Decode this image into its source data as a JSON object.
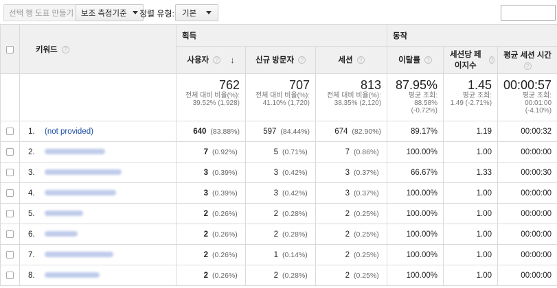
{
  "toolbar": {
    "create_label": "선택 행 도표 만들기",
    "secondary_dim_label": "보조 측정기준",
    "sort_type_label": "정렬 유형:",
    "sort_type_value": "기본"
  },
  "table": {
    "keyword_header": "키워드",
    "groups": {
      "acquisition": "획득",
      "behavior": "동작"
    },
    "columns": {
      "users": "사용자",
      "new_users": "신규 방문자",
      "sessions": "세션",
      "bounce_rate": "이탈률",
      "pages_per_session": "세션당 페이지수",
      "avg_session_duration": "평균 세션 시간"
    },
    "totals": {
      "users": {
        "value": "762",
        "l1": "전체 대비 비율(%):",
        "l2": "39.52% (1,928)"
      },
      "new_users": {
        "value": "707",
        "l1": "전체 대비 비율(%):",
        "l2": "41.10% (1,720)"
      },
      "sessions": {
        "value": "813",
        "l1": "전체 대비 비율(%):",
        "l2": "38.35% (2,120)"
      },
      "bounce_rate": {
        "value": "87.95%",
        "l1": "평균 조회:",
        "l2": "88.58%",
        "l3": "(-0.72%)"
      },
      "pages_per_session": {
        "value": "1.45",
        "l1": "평균 조회:",
        "l2": "1.49 (-2.71%)"
      },
      "avg_session_duration": {
        "value": "00:00:57",
        "l1": "평균 조회:",
        "l2": "00:01:00",
        "l3": "(-4.10%)"
      }
    },
    "rows": [
      {
        "idx": "1.",
        "keyword": "(not provided)",
        "users": "640",
        "users_pct": "(83.88%)",
        "new_users": "597",
        "new_users_pct": "(84.44%)",
        "sessions": "674",
        "sessions_pct": "(82.90%)",
        "bounce": "89.17%",
        "pps": "1.19",
        "dur": "00:00:32"
      },
      {
        "idx": "2.",
        "keyword": "",
        "users": "7",
        "users_pct": "(0.92%)",
        "new_users": "5",
        "new_users_pct": "(0.71%)",
        "sessions": "7",
        "sessions_pct": "(0.86%)",
        "bounce": "100.00%",
        "pps": "1.00",
        "dur": "00:00:00"
      },
      {
        "idx": "3.",
        "keyword": "",
        "users": "3",
        "users_pct": "(0.39%)",
        "new_users": "3",
        "new_users_pct": "(0.42%)",
        "sessions": "3",
        "sessions_pct": "(0.37%)",
        "bounce": "66.67%",
        "pps": "1.33",
        "dur": "00:00:30"
      },
      {
        "idx": "4.",
        "keyword": "",
        "users": "3",
        "users_pct": "(0.39%)",
        "new_users": "3",
        "new_users_pct": "(0.42%)",
        "sessions": "3",
        "sessions_pct": "(0.37%)",
        "bounce": "100.00%",
        "pps": "1.00",
        "dur": "00:00:00"
      },
      {
        "idx": "5.",
        "keyword": "",
        "users": "2",
        "users_pct": "(0.26%)",
        "new_users": "2",
        "new_users_pct": "(0.28%)",
        "sessions": "2",
        "sessions_pct": "(0.25%)",
        "bounce": "100.00%",
        "pps": "1.00",
        "dur": "00:00:00"
      },
      {
        "idx": "6.",
        "keyword": "",
        "users": "2",
        "users_pct": "(0.26%)",
        "new_users": "2",
        "new_users_pct": "(0.28%)",
        "sessions": "2",
        "sessions_pct": "(0.25%)",
        "bounce": "100.00%",
        "pps": "1.00",
        "dur": "00:00:00"
      },
      {
        "idx": "7.",
        "keyword": "",
        "users": "2",
        "users_pct": "(0.26%)",
        "new_users": "1",
        "new_users_pct": "(0.14%)",
        "sessions": "2",
        "sessions_pct": "(0.25%)",
        "bounce": "100.00%",
        "pps": "1.00",
        "dur": "00:00:00"
      },
      {
        "idx": "8.",
        "keyword": "",
        "users": "2",
        "users_pct": "(0.26%)",
        "new_users": "2",
        "new_users_pct": "(0.28%)",
        "sessions": "2",
        "sessions_pct": "(0.25%)",
        "bounce": "100.00%",
        "pps": "1.00",
        "dur": "00:00:00"
      }
    ]
  },
  "colors": {
    "link": "#1a4ea7",
    "header_bg": "#f0f0f0",
    "border": "#dadada"
  },
  "icons": {
    "help": "help-circle-icon",
    "sort": "sort-down-arrow-icon",
    "dropdown": "chevron-down-icon"
  }
}
